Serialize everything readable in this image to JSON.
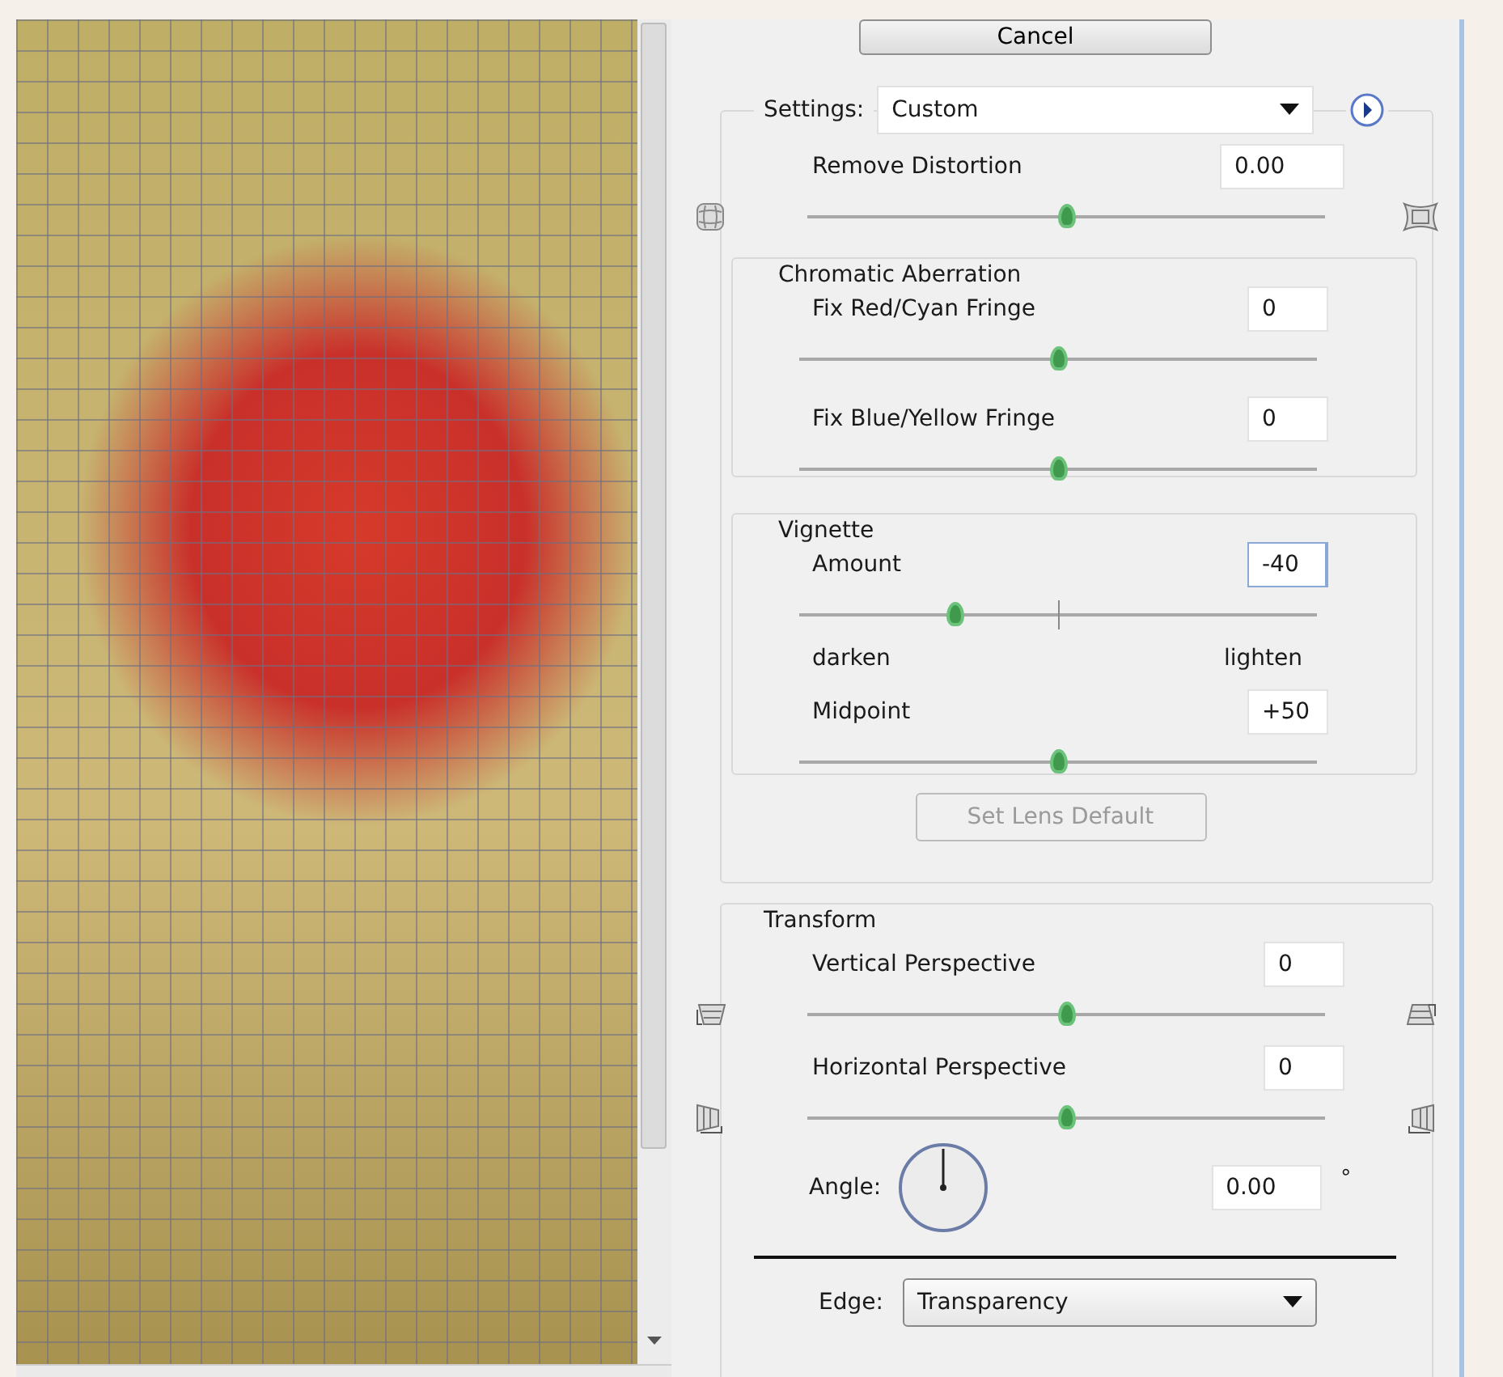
{
  "cancel_button": {
    "label": "Cancel"
  },
  "settings": {
    "label": "Settings:",
    "value": "Custom"
  },
  "remove_distortion": {
    "kind": "distortion",
    "label": "Remove Distortion",
    "value": "0.00",
    "level": 0.5
  },
  "chromatic_aberration": {
    "title": "Chromatic Aberration",
    "sliders": [
      {
        "kind": "plain",
        "label": "Fix Red/Cyan Fringe",
        "value": "0",
        "level": 0.5
      },
      {
        "kind": "plain",
        "label": "Fix Blue/Yellow Fringe",
        "value": "0",
        "level": 0.5
      }
    ]
  },
  "vignette": {
    "title": "Vignette",
    "sliders": [
      {
        "kind": "bipolar",
        "label": "Amount",
        "value": "-40",
        "level": 0.3,
        "focused": true,
        "scale_labels": [
          "darken",
          "lighten"
        ]
      },
      {
        "kind": "plain",
        "label": "Midpoint",
        "value": "+50",
        "level": 0.5,
        "focused": false
      }
    ]
  },
  "set_lens_default": {
    "label": "Set Lens Default",
    "disabled": true
  },
  "transform": {
    "title": "Transform",
    "sliders": [
      {
        "kind": "vertical",
        "label": "Vertical Perspective",
        "value": "0",
        "level": 0.5
      },
      {
        "kind": "horizontal",
        "label": "Horizontal Perspective",
        "value": "0",
        "level": 0.5
      }
    ],
    "angle": {
      "label": "Angle:",
      "value": "0.00",
      "unit": "°"
    }
  },
  "edge": {
    "label": "Edge:",
    "value": "Transparency"
  }
}
